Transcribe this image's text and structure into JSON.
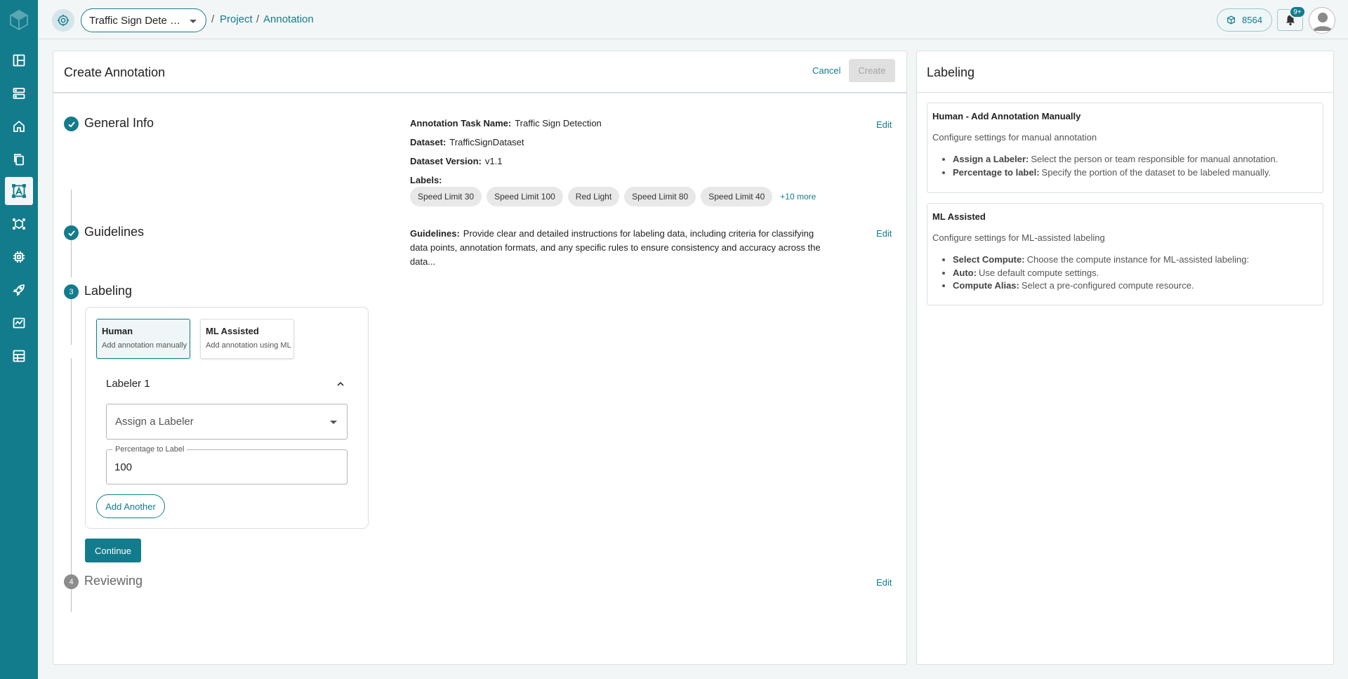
{
  "header": {
    "project_name": "Traffic Sign Dete …",
    "breadcrumb": [
      {
        "sep": "/",
        "label": "Project"
      },
      {
        "sep": "/",
        "label": "Annotation"
      }
    ],
    "credits": "8564",
    "notifications_badge": "9+"
  },
  "sidebar": {
    "items": [
      {
        "icon": "dashboard-icon"
      },
      {
        "icon": "database-icon"
      },
      {
        "icon": "home-icon"
      },
      {
        "icon": "files-icon"
      },
      {
        "icon": "annotation-icon",
        "active": true
      },
      {
        "icon": "model-icon"
      },
      {
        "icon": "compute-icon"
      },
      {
        "icon": "deploy-icon"
      },
      {
        "icon": "monitor-icon"
      },
      {
        "icon": "reports-icon"
      }
    ]
  },
  "main": {
    "title": "Create Annotation",
    "cancel_label": "Cancel",
    "create_label": "Create",
    "steps": {
      "general": {
        "title": "General Info",
        "edit_label": "Edit",
        "task_name_label": "Annotation Task Name:",
        "task_name": "Traffic Sign Detection",
        "dataset_label": "Dataset:",
        "dataset": "TrafficSignDataset",
        "version_label": "Dataset Version:",
        "version": "v1.1",
        "labels_label": "Labels:",
        "labels": [
          "Speed Limit 30",
          "Speed Limit 100",
          "Red Light",
          "Speed Limit 80",
          "Speed Limit 40"
        ],
        "more_label": "+10 more"
      },
      "guidelines": {
        "title": "Guidelines",
        "edit_label": "Edit",
        "label": "Guidelines:",
        "text": "Provide clear and detailed instructions for labeling data, including criteria for classifying data points, annotation formats, and any specific rules to ensure consistency and accuracy across the data..."
      },
      "labeling": {
        "number": "3",
        "title": "Labeling",
        "modes": [
          {
            "title": "Human",
            "subtitle": "Add annotation manually"
          },
          {
            "title": "ML Assisted",
            "subtitle": "Add annotation using ML"
          }
        ],
        "labeler_title": "Labeler 1",
        "assign_placeholder": "Assign a Labeler",
        "percentage_label": "Percentage to Label",
        "percentage_value": "100",
        "add_another_label": "Add Another",
        "continue_label": "Continue"
      },
      "reviewing": {
        "number": "4",
        "title": "Reviewing",
        "edit_label": "Edit"
      }
    }
  },
  "side": {
    "title": "Labeling",
    "human": {
      "title": "Human - Add Annotation Manually",
      "desc": "Configure settings for manual annotation",
      "items": [
        {
          "term": "Assign a Labeler:",
          "text": "Select the person or team responsible for manual annotation."
        },
        {
          "term": "Percentage to label:",
          "text": "Specify the portion of the dataset to be labeled manually."
        }
      ]
    },
    "ml": {
      "title": "ML Assisted",
      "desc": "Configure settings for ML-assisted labeling",
      "items": [
        {
          "term": "Select Compute:",
          "text": "Choose the compute instance for ML-assisted labeling:"
        },
        {
          "term": "Auto:",
          "text": "Use default compute settings."
        },
        {
          "term": "Compute Alias:",
          "text": "Select a pre-configured compute resource."
        }
      ]
    }
  }
}
